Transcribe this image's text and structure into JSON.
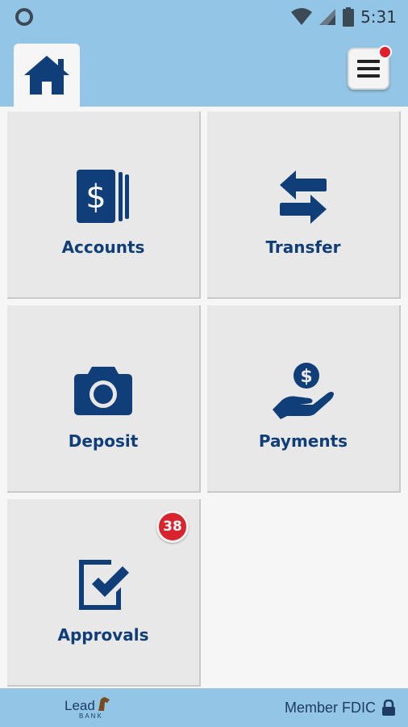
{
  "status_bar": {
    "time": "5:31",
    "icons": [
      "circle-indicator-icon",
      "wifi-icon",
      "signal-icon",
      "battery-icon"
    ]
  },
  "header": {
    "home_icon": "home-icon",
    "menu_icon": "hamburger-menu-icon",
    "menu_notification": true
  },
  "tiles": [
    {
      "label": "Accounts",
      "icon": "accounts-dollar-cards-icon"
    },
    {
      "label": "Transfer",
      "icon": "transfer-arrows-icon"
    },
    {
      "label": "Deposit",
      "icon": "camera-icon"
    },
    {
      "label": "Payments",
      "icon": "hand-coin-icon"
    },
    {
      "label": "Approvals",
      "icon": "checkbox-approve-icon",
      "badge": "38"
    }
  ],
  "footer": {
    "logo_text": "Lead",
    "logo_subtext": "BANK",
    "fdic_text": "Member FDIC",
    "lock_icon": "lock-icon"
  },
  "colors": {
    "header_bg": "#93c6e6",
    "brand_navy": "#0f3e78",
    "tile_bg": "#e8e8e8",
    "badge_red": "#d9232e"
  }
}
